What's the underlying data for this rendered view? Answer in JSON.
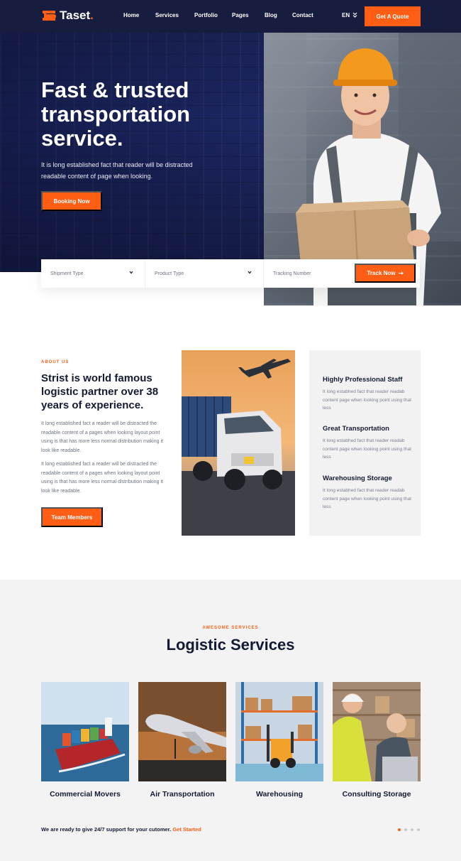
{
  "colors": {
    "accent": "#ff5e14",
    "navy": "#171d3f",
    "heading": "#141a33",
    "panel": "#f2f2f3"
  },
  "brand": {
    "name": "Taset",
    "dot": "."
  },
  "nav": {
    "links": [
      "Home",
      "Services",
      "Portfolio",
      "Pages",
      "Blog",
      "Contact"
    ],
    "language": "EN",
    "quote_label": "Get A Quote"
  },
  "hero": {
    "title": "Fast & trusted transportation service.",
    "description": "It is long established fact that reader will be distracted readable content of page when looking.",
    "cta_label": "Booking Now"
  },
  "tracking": {
    "shipment_type": "Shipment Type",
    "product_type": "Product Type",
    "tracking_placeholder": "Tracking Number",
    "button_label": "Track Now",
    "button_icon": "arrow-right-icon"
  },
  "about": {
    "eyebrow": "ABOUT US",
    "title": "Strist is world famous logistic partner over 38 years of experience.",
    "paragraph_1": "It long established fact a reader will be distracted the readable content of a pages when looking layout point using is that has more less normal distribution making it look like readable.",
    "paragraph_2": "It long established fact a reader will be distracted the readable content of a pages when looking layout point using is that has more less normal distribution making it look like readable.",
    "button_label": "Team Members",
    "features": [
      {
        "title": "Highly Professional Staff",
        "text": "It long estabhed fact that reader readab content page when looking point using that less"
      },
      {
        "title": "Great Transportation",
        "text": "It long estabhed fact that reader readab content page when looking point using that less"
      },
      {
        "title": "Warehousing Storage",
        "text": "It long estabhed fact that reader readab content page when looking point using that less"
      }
    ]
  },
  "services": {
    "eyebrow": "AWESOME SERVICES",
    "title": "Logistic Services",
    "cards": [
      {
        "label": "Commercial Movers"
      },
      {
        "label": "Air Transportation"
      },
      {
        "label": "Warehousing"
      },
      {
        "label": "Consulting Storage"
      }
    ],
    "support_text": "We are ready to give 24/7 support for your cutomer.",
    "support_link": "Get Started",
    "slider_pages": 4,
    "slider_active": 1
  }
}
